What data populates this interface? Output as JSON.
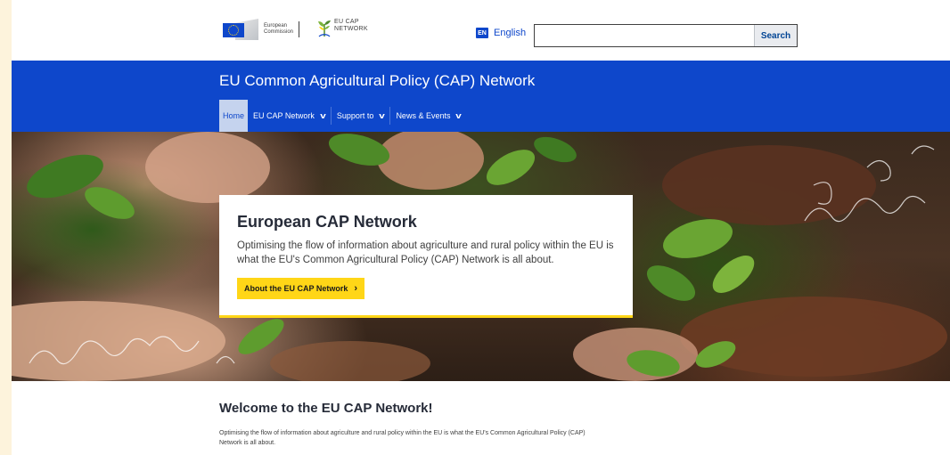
{
  "header": {
    "ec_logo_text": [
      "European",
      "Commission"
    ],
    "cap_logo_text": [
      "EU CAP",
      "NETWORK"
    ],
    "language": {
      "code": "EN",
      "label": "English"
    },
    "search": {
      "placeholder": "",
      "value": "",
      "button_label": "Search"
    }
  },
  "site": {
    "title": "EU Common Agricultural Policy (CAP) Network",
    "nav": [
      {
        "label": "Home",
        "active": true,
        "dropdown": false
      },
      {
        "label": "EU CAP Network",
        "active": false,
        "dropdown": true
      },
      {
        "label": "Support to",
        "active": false,
        "dropdown": true
      },
      {
        "label": "News & Events",
        "active": false,
        "dropdown": true
      }
    ],
    "chevron": "⌄"
  },
  "hero": {
    "title": "European CAP Network",
    "text": "Optimising the flow of information about agriculture and rural policy within the EU is what the EU's Common Agricultural Policy (CAP) Network is all about.",
    "cta_label": "About the EU CAP Network",
    "cta_icon": "chevron-right-icon"
  },
  "welcome": {
    "title": "Welcome to the EU CAP Network!",
    "text": "Optimising the flow of information about agriculture and rural policy within the EU is what the EU's Common Agricultural Policy (CAP) Network is all about."
  },
  "colors": {
    "primary_blue": "#0e47cb",
    "accent_yellow": "#ffd617",
    "nav_active_bg": "#c5d3ee",
    "outer_bg": "#fdf3dc"
  }
}
